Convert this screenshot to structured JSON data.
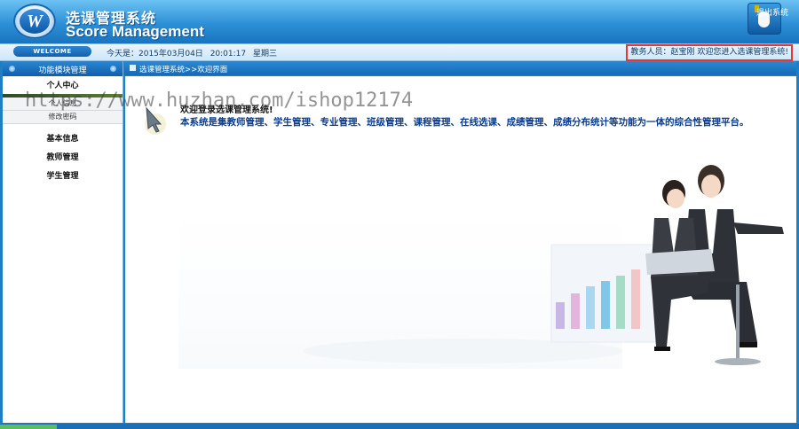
{
  "header": {
    "logo_letter": "W",
    "title_cn": "选课管理系统",
    "title_en": "Score Management",
    "exit_label": "退出系统"
  },
  "statusbar": {
    "welcome_label": "WELCOME",
    "date_label": "今天是：2015年03月04日",
    "time": "20:01:17",
    "weekday": "星期三",
    "greeting": "教务人员：赵宝刚   欢迎您进入选课管理系统!"
  },
  "sidebar": {
    "title": "功能模块管理",
    "groups": [
      {
        "label": "个人中心"
      },
      {
        "label": "基本信息"
      },
      {
        "label": "教师管理"
      },
      {
        "label": "学生管理"
      }
    ],
    "sub_items": [
      {
        "label": "个人信息"
      },
      {
        "label": "修改密码"
      }
    ]
  },
  "content": {
    "breadcrumb": "选课管理系统>>欢迎界面",
    "welcome_title": "欢迎登录选课管理系统!",
    "description": "本系统是集教师管理、学生管理、专业管理、班级管理、课程管理、在线选课、成绩管理、成绩分布统计等功能为一体的综合性管理平台。"
  },
  "watermark": "https://www.huzhan.com/ishop12174",
  "icons": [
    "logo-icon",
    "exit-mouse-icon",
    "home-icon",
    "pointer-arrow-icon"
  ],
  "colors": {
    "header_blue": "#2d8fd6",
    "accent_blue": "#146bb6",
    "description_text": "#0b3c8c",
    "greeting_border": "#e03a3a"
  }
}
